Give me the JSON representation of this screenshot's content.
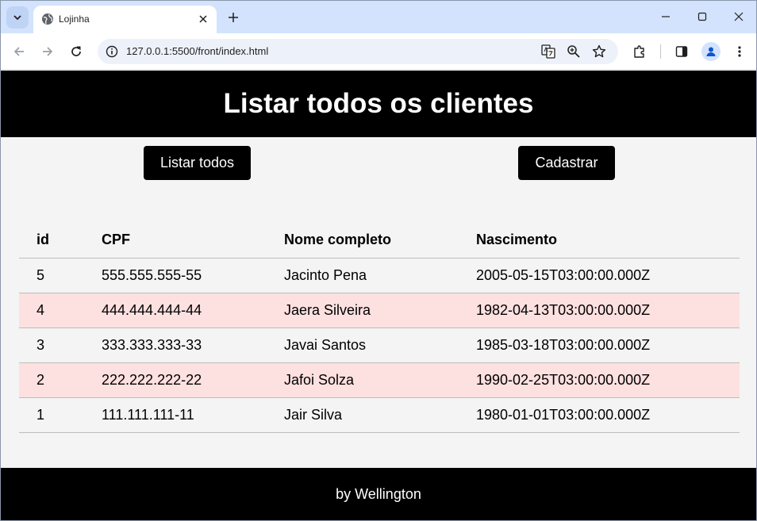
{
  "browser": {
    "tab_title": "Lojinha",
    "url": "127.0.0.1:5500/front/index.html"
  },
  "page": {
    "title": "Listar todos os clientes",
    "buttons": {
      "list_all": "Listar todos",
      "register": "Cadastrar"
    },
    "table": {
      "headers": [
        "id",
        "CPF",
        "Nome completo",
        "Nascimento"
      ],
      "rows": [
        [
          "5",
          "555.555.555-55",
          "Jacinto Pena",
          "2005-05-15T03:00:00.000Z"
        ],
        [
          "4",
          "444.444.444-44",
          "Jaera Silveira",
          "1982-04-13T03:00:00.000Z"
        ],
        [
          "3",
          "333.333.333-33",
          "Javai Santos",
          "1985-03-18T03:00:00.000Z"
        ],
        [
          "2",
          "222.222.222-22",
          "Jafoi Solza",
          "1990-02-25T03:00:00.000Z"
        ],
        [
          "1",
          "111.111.111-11",
          "Jair Silva",
          "1980-01-01T03:00:00.000Z"
        ]
      ]
    },
    "footer": "by Wellington"
  },
  "colors": {
    "header_bg": "#000000",
    "row_alt_bg": "#fde0e0",
    "page_bg": "#f4f4f4",
    "tabstrip_bg": "#d3e3fd"
  },
  "icons": [
    "tab-search-icon",
    "globe-icon",
    "close-icon",
    "plus-icon",
    "minimize-icon",
    "maximize-icon",
    "window-close-icon",
    "back-icon",
    "forward-icon",
    "reload-icon",
    "info-icon",
    "translate-icon",
    "zoom-icon",
    "star-icon",
    "extensions-icon",
    "side-panel-icon",
    "profile-icon",
    "menu-icon"
  ]
}
